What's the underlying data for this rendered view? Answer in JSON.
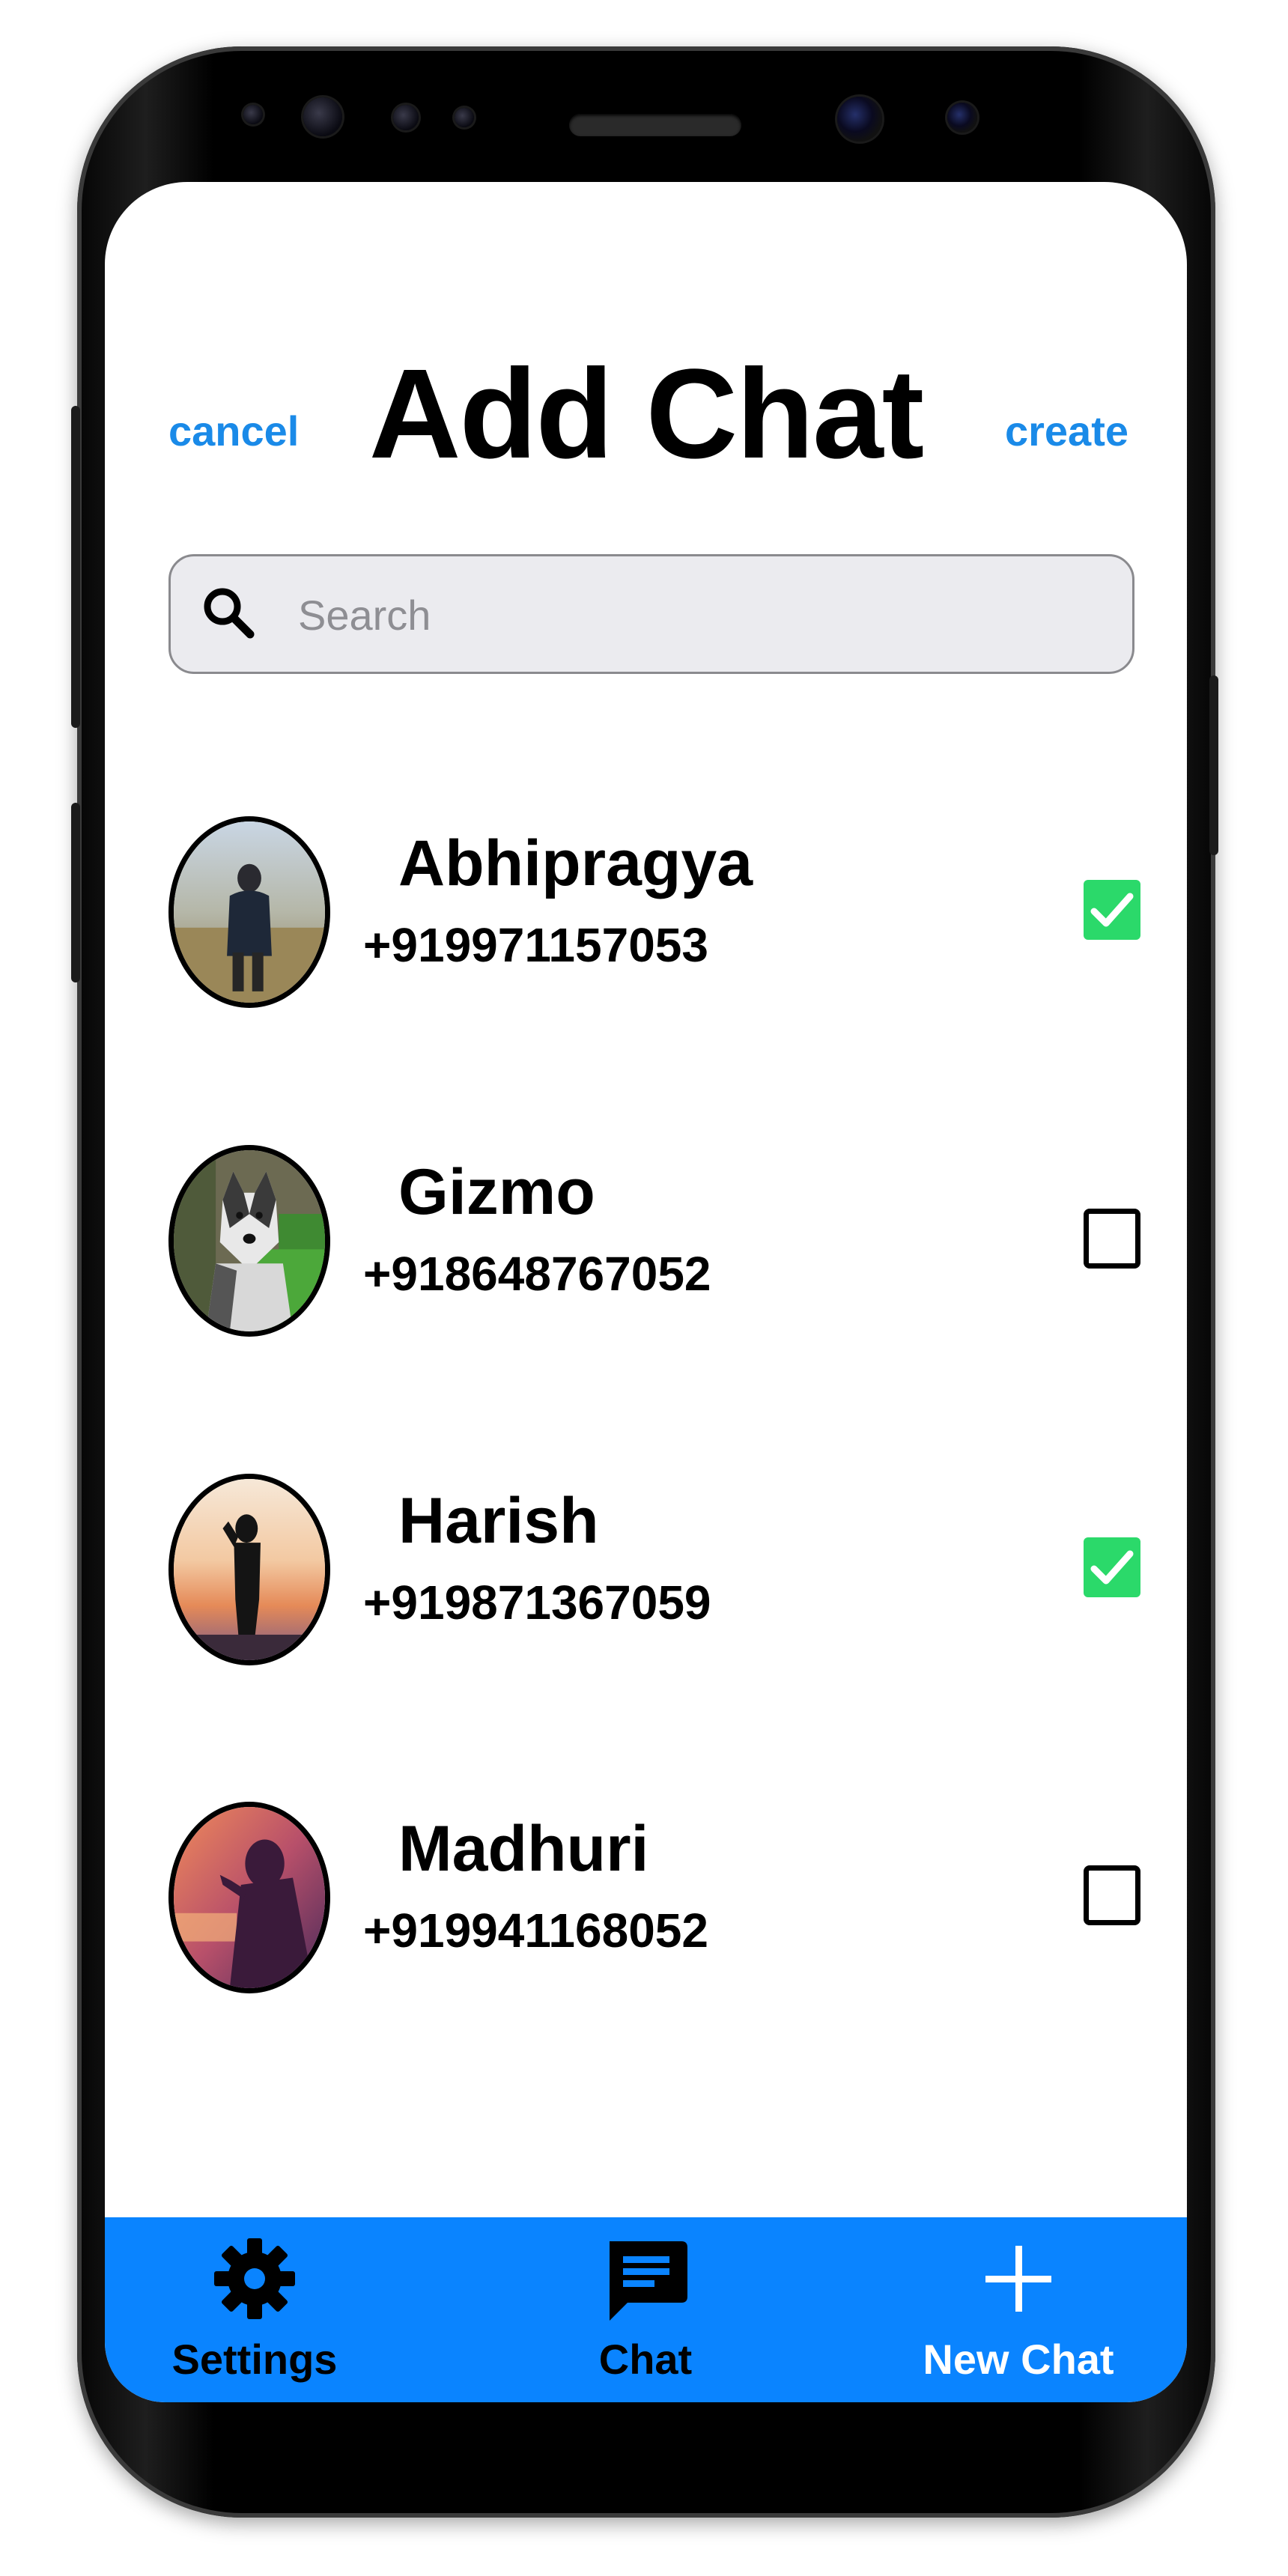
{
  "header": {
    "cancel_label": "cancel",
    "title": "Add Chat",
    "create_label": "create"
  },
  "search": {
    "placeholder": "Search",
    "value": "",
    "icon": "search-icon"
  },
  "contacts": [
    {
      "name": "Abhipragya",
      "phone": "+919971157053",
      "selected": true,
      "avatar": "person-in-field-photo"
    },
    {
      "name": "Gizmo",
      "phone": "+918648767052",
      "selected": false,
      "avatar": "husky-dog-photo"
    },
    {
      "name": "Harish",
      "phone": "+919871367059",
      "selected": true,
      "avatar": "silhouette-sunset-photo"
    },
    {
      "name": "Madhuri",
      "phone": "+919941168052",
      "selected": false,
      "avatar": "woman-sunset-photo"
    }
  ],
  "tabbar": {
    "tabs": [
      {
        "label": "Settings",
        "icon": "gear-icon"
      },
      {
        "label": "Chat",
        "icon": "chat-bubble-icon"
      },
      {
        "label": "New Chat",
        "icon": "plus-icon"
      }
    ]
  },
  "colors": {
    "accent": "#1a8ae8",
    "tabbar": "#0a84ff",
    "checked": "#2bd96a",
    "search_bg": "#ebebef"
  }
}
